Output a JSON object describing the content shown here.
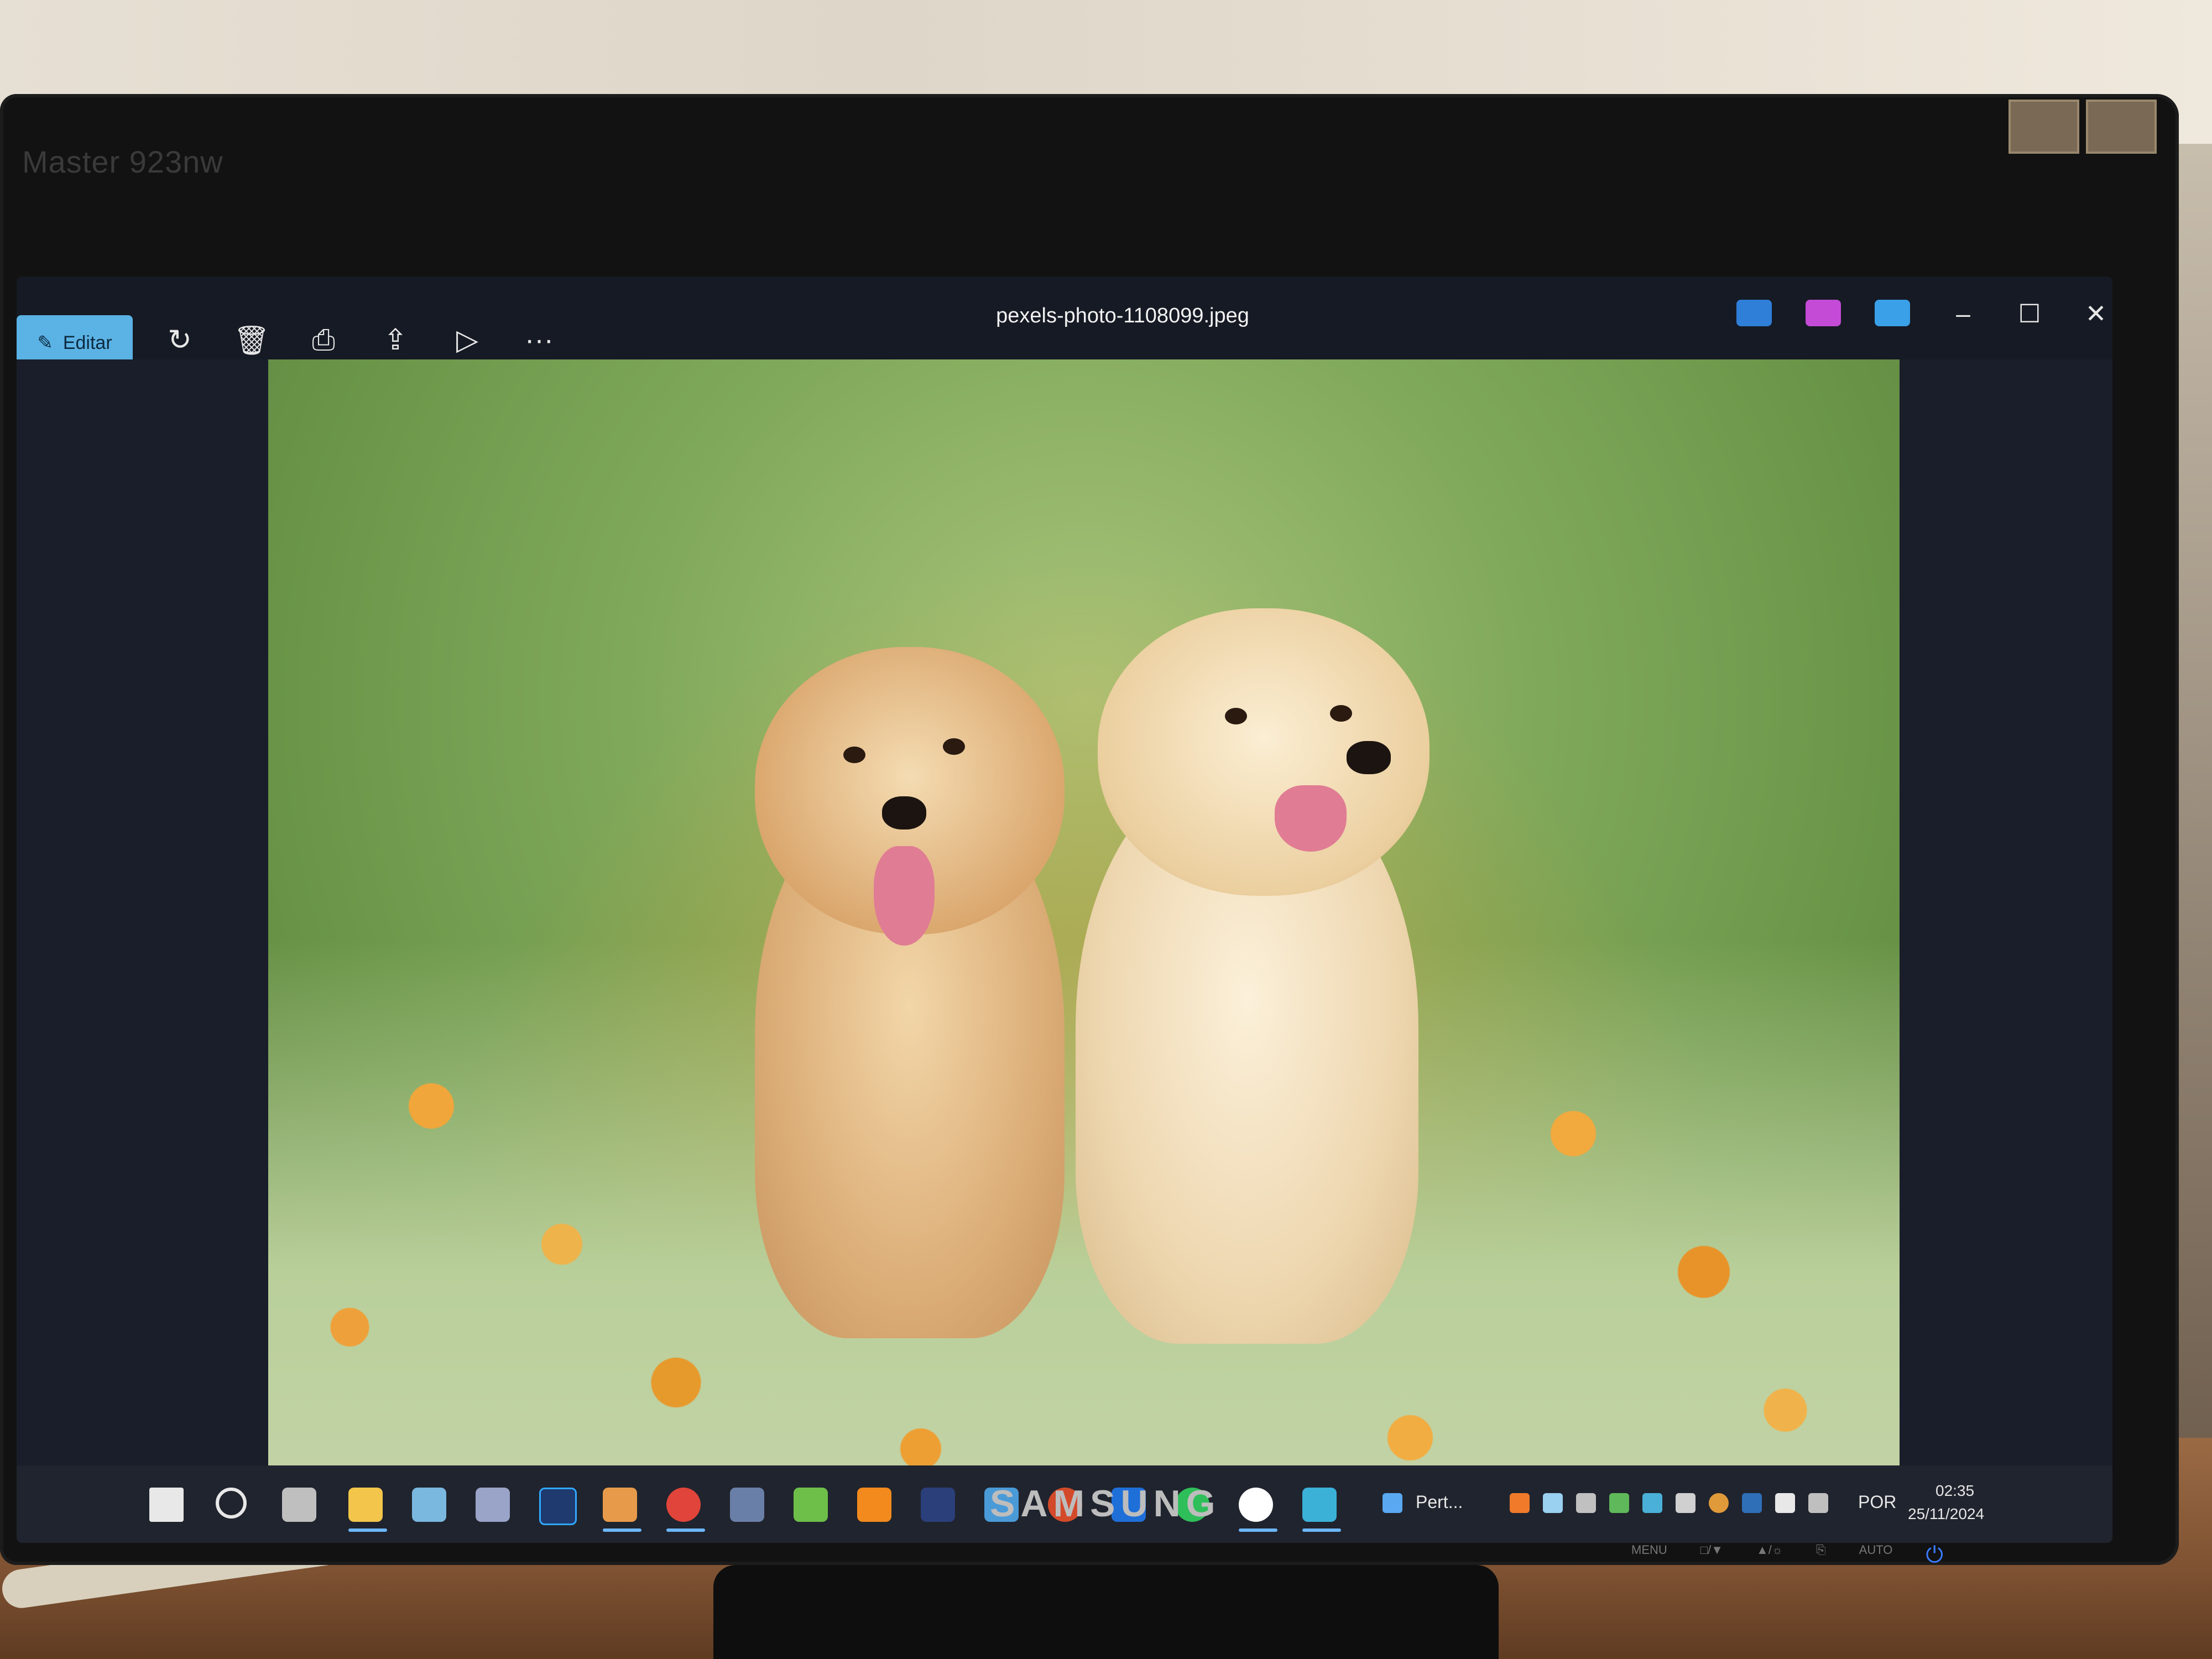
{
  "monitor": {
    "bezel_label": "Master 923nw",
    "brand": "SAMSUNG",
    "hw_buttons": [
      "MENU",
      "□/▼",
      "▲/☼",
      "⎘",
      "AUTO"
    ]
  },
  "viewer": {
    "edit_label": "Editar",
    "file_title": "pexels-photo-1108099.jpeg",
    "toolbar_icons": [
      "rotate-icon",
      "delete-icon",
      "print-icon",
      "share-icon",
      "slideshow-icon",
      "more-icon"
    ],
    "more_glyph": "···"
  },
  "taskbar": {
    "weather_label": "Pert...",
    "language": "POR",
    "time": "02:35",
    "date": "25/11/2024"
  }
}
